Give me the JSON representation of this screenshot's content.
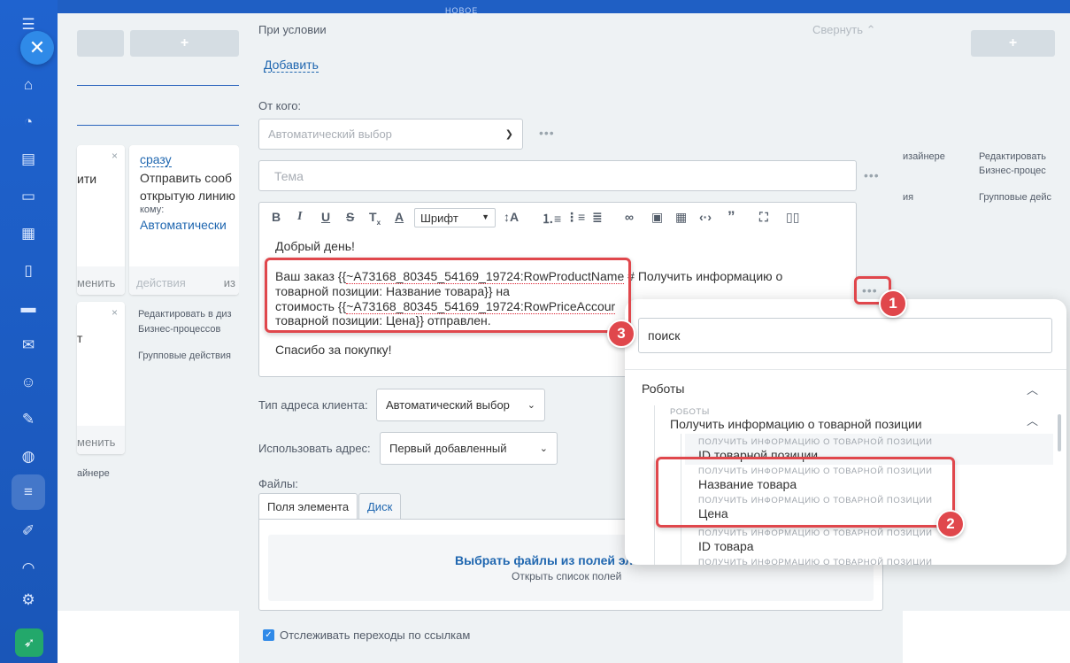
{
  "header": {
    "new_label": "НОВОЕ"
  },
  "board": {
    "add_symbol": "+",
    "card1": {
      "text": "ити",
      "close": "×",
      "footer": "менить"
    },
    "card2": {
      "link": "сразу",
      "line1": "Отправить сооб",
      "line2": "открытую линию",
      "who_label": "кому:",
      "who_value": "Автоматически",
      "footer_left": "действия",
      "footer_right": "из"
    },
    "card3": {
      "text": "т",
      "close": "×",
      "footer": "менить"
    },
    "actions": {
      "edit_designer_l1": "Редактировать в диз",
      "edit_designer_l2": "Бизнес-процессов",
      "group_actions": "Групповые действия",
      "designer_tail": "айнере"
    },
    "right_actions": {
      "designer_tail": "изайнере",
      "tail2": "ия",
      "edit_l1": "Редактировать",
      "edit_l2": "Бизнес-процес",
      "group": "Групповые дейс"
    }
  },
  "modal": {
    "condition_label": "При условии",
    "collapse_label": "Свернуть",
    "add_link": "Добавить",
    "from_label": "От кого:",
    "from_value": "Автоматический выбор",
    "subject_placeholder": "Тема",
    "font_label": "Шрифт",
    "editor": {
      "greeting": "Добрый день!",
      "line1_prefix": "Ваш заказ {{",
      "line1_var": "~A73168_80345_54169_19724:RowProductName",
      "line1_suffix": " # Получить информацию о",
      "line2": "товарной позиции: Название товара}} на",
      "line3_prefix": "стоимость {{",
      "line3_var": "~A73168_80345_54169_19724:RowPriceAccour",
      "line4": "товарной позиции: Цена}} отправлен.",
      "thanks": "Спасибо за покупку!"
    },
    "address_type_label": "Тип адреса клиента:",
    "address_type_value": "Автоматический выбор",
    "use_address_label": "Использовать адрес:",
    "use_address_value": "Первый добавленный",
    "files_label": "Файлы:",
    "tabs": [
      "Поля элемента",
      "Диск"
    ],
    "choose_files": "Выбрать файлы из полей эл",
    "open_fields": "Открыть список полей",
    "track_links": "Отслеживать переходы по ссылкам"
  },
  "popup": {
    "search_placeholder": "поиск",
    "section": "Роботы",
    "group_caption": "РОБОТЫ",
    "group_title": "Получить информацию о товарной позиции",
    "items": [
      {
        "caption": "ПОЛУЧИТЬ ИНФОРМАЦИЮ О ТОВАРНОЙ ПОЗИЦИИ",
        "label": "ID товарной позиции"
      },
      {
        "caption": "ПОЛУЧИТЬ ИНФОРМАЦИЮ О ТОВАРНОЙ ПОЗИЦИИ",
        "label": "Название товара"
      },
      {
        "caption": "ПОЛУЧИТЬ ИНФОРМАЦИЮ О ТОВАРНОЙ ПОЗИЦИИ",
        "label": "Цена"
      },
      {
        "caption": "ПОЛУЧИТЬ ИНФОРМАЦИЮ О ТОВАРНОЙ ПОЗИЦИИ",
        "label": "ID товара"
      },
      {
        "caption": "ПОЛУЧИТЬ ИНФОРМАЦИЮ О ТОВАРНОЙ ПОЗИЦИИ",
        "label": ""
      }
    ]
  },
  "annotations": {
    "badge1": "1",
    "badge2": "2",
    "badge3": "3"
  },
  "colors": {
    "accent": "#2f8ae8",
    "annotation_red": "#e0474c",
    "sidebar": "#1f5fc4",
    "success": "#23a86b"
  }
}
